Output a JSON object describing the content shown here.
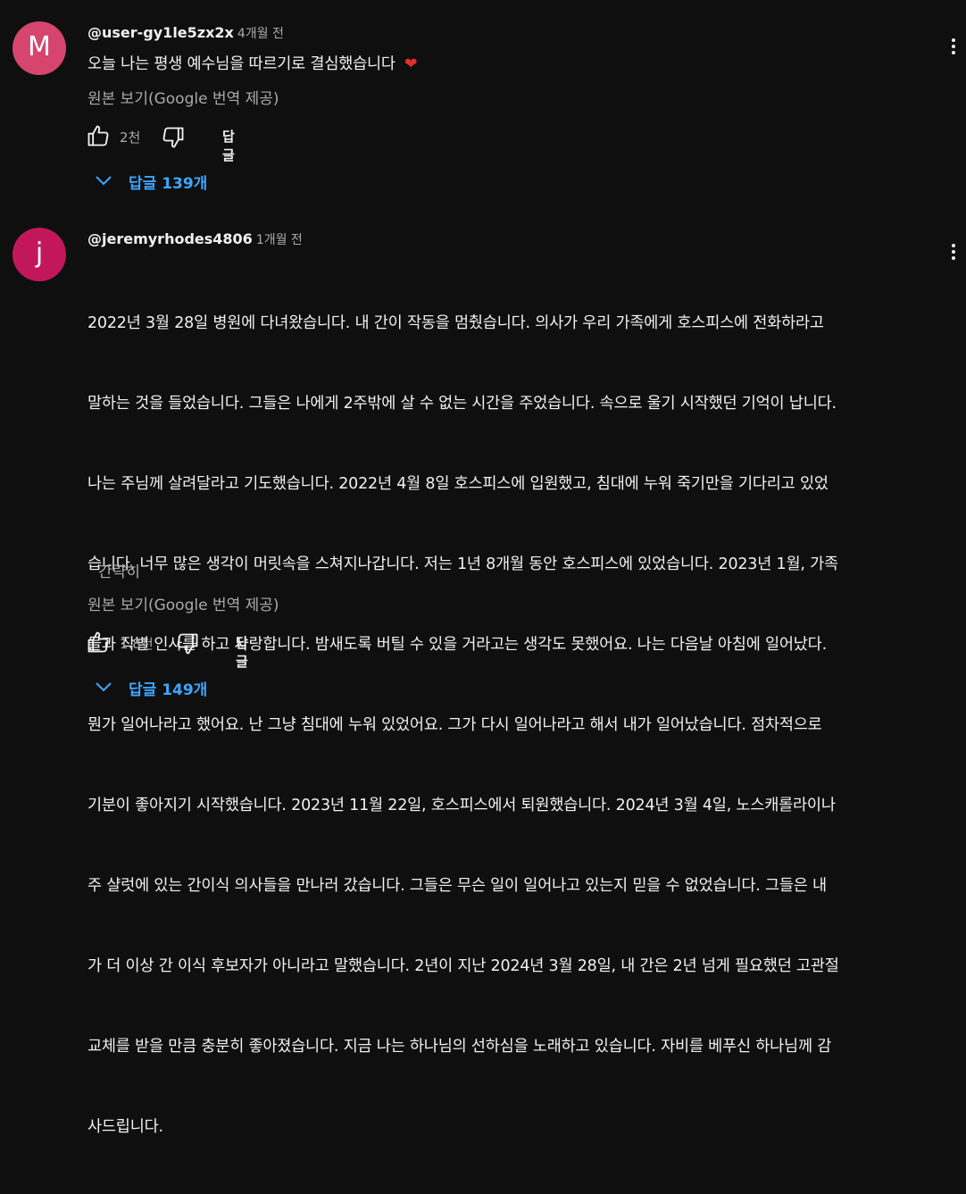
{
  "comments": [
    {
      "avatar_letter": "M",
      "avatar_color": "#d6456e",
      "author": "@user-gy1le5zx2x",
      "time": "4개월 전",
      "text": "오늘 나는 평생 예수님을 따르기로 결심했습니다",
      "emoji": "❤",
      "translation_note": "원본 보기(Google 번역 제공)",
      "likes": "2천",
      "reply_label": "답글",
      "replies_label": "답글 139개"
    },
    {
      "avatar_letter": "j",
      "avatar_color": "#c2185b",
      "author": "@jeremyrhodes4806",
      "time": "1개월 전",
      "lines": [
        "2022년 3월 28일 병원에 다녀왔습니다. 내 간이 작동을 멈췄습니다. 의사가 우리 가족에게 호스피스에 전화하라고",
        "말하는 것을 들었습니다. 그들은 나에게 2주밖에 살 수 없는 시간을 주었습니다. 속으로 울기 시작했던 기억이 납니다.",
        "나는 주님께 살려달라고 기도했습니다. 2022년 4월 8일 호스피스에 입원했고, 침대에 누워 죽기만을 기다리고 있었",
        "습니다. 너무 많은 생각이 머릿속을 스쳐지나갑니다. 저는 1년 8개월 동안 호스피스에 있었습니다. 2023년 1월, 가족",
        "들과 작별 인사를 하고 사랑합니다. 밤새도록 버틸 수 있을 거라고는 생각도 못했어요. 나는 다음날 아침에 일어났다.",
        "뭔가 일어나라고 했어요. 난 그냥 침대에 누워 있었어요. 그가 다시 일어나라고 해서 내가 일어났습니다. 점차적으로",
        "기분이 좋아지기 시작했습니다. 2023년 11월 22일, 호스피스에서 퇴원했습니다. 2024년 3월 4일, 노스캐롤라이나",
        "주 샬럿에 있는 간이식 의사들을 만나러 갔습니다. 그들은 무슨 일이 일어나고 있는지 믿을 수 없었습니다. 그들은 내",
        "가 더 이상 간 이식 후보자가 아니라고 말했습니다. 2년이 지난 2024년 3월 28일, 내 간은 2년 넘게 필요했던 고관절",
        "교체를 받을 만큼 충분히 좋아졌습니다. 지금 나는 하나님의 선하심을 노래하고 있습니다. 자비를 베푸신 하나님께 감",
        "사드립니다."
      ],
      "collapse_label": "간략히",
      "translation_note": "원본 보기(Google 번역 제공)",
      "likes": "1.8천",
      "reply_label": "답글",
      "replies_label": "답글 149개"
    }
  ]
}
